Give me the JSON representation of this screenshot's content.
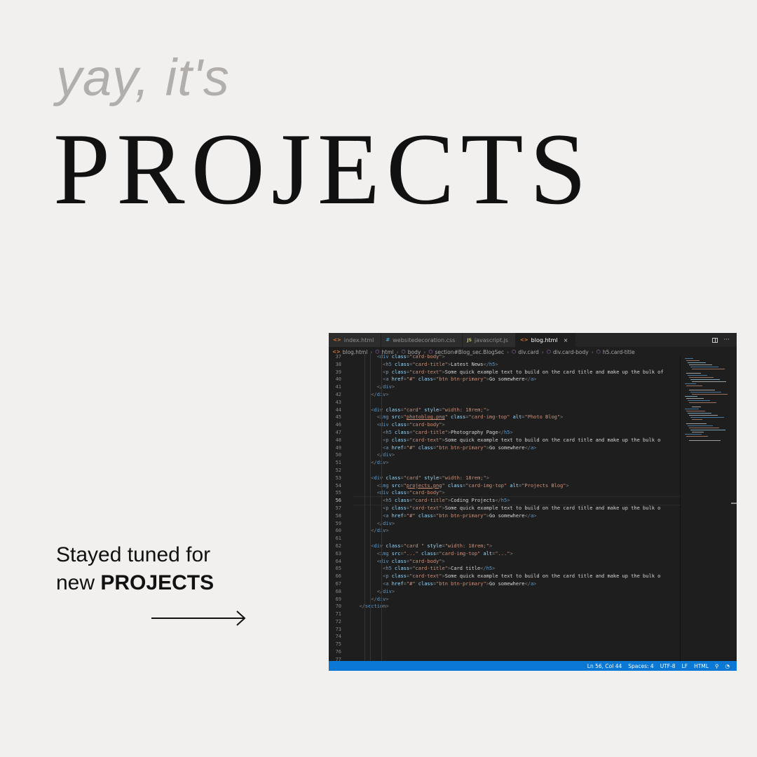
{
  "hero": {
    "kicker": "yay, it's",
    "headline": "PROJECTS",
    "tagline_line1": "Stayed tuned for",
    "tagline_line2_prefix": "new ",
    "tagline_line2_bold": "PROJECTS"
  },
  "editor": {
    "tabs": [
      {
        "label": "index.html",
        "icon": "<>",
        "type": "html"
      },
      {
        "label": "websitedecoration.css",
        "icon": "#",
        "type": "css"
      },
      {
        "label": "javascript.js",
        "icon": "JS",
        "type": "js"
      },
      {
        "label": "blog.html",
        "icon": "<>",
        "type": "html",
        "active": true,
        "close": "×"
      }
    ],
    "tab_actions": {
      "more": "···"
    },
    "breadcrumb": [
      {
        "label": "blog.html",
        "icon": "<>"
      },
      {
        "label": "html",
        "icon": "⬡"
      },
      {
        "label": "body",
        "icon": "⬡"
      },
      {
        "label": "section#Blog_sec.BlogSec",
        "icon": "⬡"
      },
      {
        "label": "div.card",
        "icon": "⬡"
      },
      {
        "label": "div.card-body",
        "icon": "⬡"
      },
      {
        "label": "h5.card-title",
        "icon": "⬡"
      }
    ],
    "line_numbers": [
      "37",
      "38",
      "39",
      "40",
      "41",
      "42",
      "43",
      "44",
      "45",
      "46",
      "47",
      "48",
      "49",
      "50",
      "51",
      "52",
      "53",
      "54",
      "55",
      "56",
      "57",
      "58",
      "59",
      "60",
      "61",
      "62",
      "63",
      "64",
      "65",
      "66",
      "67",
      "68",
      "69",
      "70",
      "71",
      "72",
      "73",
      "74",
      "75",
      "76",
      "77"
    ],
    "current_line": "56",
    "status": {
      "position": "Ln 56, Col 44",
      "spaces": "Spaces: 4",
      "encoding": "UTF-8",
      "eol": "LF",
      "language": "HTML"
    },
    "code_lines": [
      [
        [
          "        ",
          "p"
        ],
        [
          "<",
          "p"
        ],
        [
          "div",
          "t"
        ],
        [
          " class",
          "a"
        ],
        [
          "=",
          "p"
        ],
        [
          "\"card-body\"",
          "s"
        ],
        [
          ">",
          "p"
        ]
      ],
      [
        [
          "          ",
          "p"
        ],
        [
          "<",
          "p"
        ],
        [
          "h5",
          "t"
        ],
        [
          " class",
          "a"
        ],
        [
          "=",
          "p"
        ],
        [
          "\"card-title\"",
          "s"
        ],
        [
          ">",
          "p"
        ],
        [
          "Latest News",
          "x"
        ],
        [
          "</",
          "p"
        ],
        [
          "h5",
          "t"
        ],
        [
          ">",
          "p"
        ]
      ],
      [
        [
          "          ",
          "p"
        ],
        [
          "<",
          "p"
        ],
        [
          "p",
          "t"
        ],
        [
          " class",
          "a"
        ],
        [
          "=",
          "p"
        ],
        [
          "\"card-text\"",
          "s"
        ],
        [
          ">",
          "p"
        ],
        [
          "Some quick example text to build on the card title and make up the bulk of",
          "x"
        ]
      ],
      [
        [
          "          ",
          "p"
        ],
        [
          "<",
          "p"
        ],
        [
          "a",
          "t"
        ],
        [
          " href",
          "a"
        ],
        [
          "=",
          "p"
        ],
        [
          "\"#\"",
          "s"
        ],
        [
          " class",
          "a"
        ],
        [
          "=",
          "p"
        ],
        [
          "\"btn btn-primary\"",
          "s"
        ],
        [
          ">",
          "p"
        ],
        [
          "Go somewhere",
          "x"
        ],
        [
          "</",
          "p"
        ],
        [
          "a",
          "t"
        ],
        [
          ">",
          "p"
        ]
      ],
      [
        [
          "        ",
          "p"
        ],
        [
          "</",
          "p"
        ],
        [
          "div",
          "t"
        ],
        [
          ">",
          "p"
        ]
      ],
      [
        [
          "      ",
          "p"
        ],
        [
          "</",
          "p"
        ],
        [
          "div",
          "t"
        ],
        [
          ">",
          "p"
        ]
      ],
      [
        [
          "",
          "x"
        ]
      ],
      [
        [
          "      ",
          "p"
        ],
        [
          "<",
          "p"
        ],
        [
          "div",
          "t"
        ],
        [
          " class",
          "a"
        ],
        [
          "=",
          "p"
        ],
        [
          "\"card\"",
          "s"
        ],
        [
          " style",
          "a"
        ],
        [
          "=",
          "p"
        ],
        [
          "\"width: 18rem;\"",
          "s"
        ],
        [
          ">",
          "p"
        ]
      ],
      [
        [
          "        ",
          "p"
        ],
        [
          "<",
          "p"
        ],
        [
          "img",
          "t"
        ],
        [
          " src",
          "a"
        ],
        [
          "=",
          "p"
        ],
        [
          "\"",
          "s"
        ],
        [
          "photoblog.png",
          "su"
        ],
        [
          "\"",
          "s"
        ],
        [
          " class",
          "a"
        ],
        [
          "=",
          "p"
        ],
        [
          "\"card-img-top\"",
          "s"
        ],
        [
          " alt",
          "a"
        ],
        [
          "=",
          "p"
        ],
        [
          "\"Photo Blog\"",
          "s"
        ],
        [
          ">",
          "p"
        ]
      ],
      [
        [
          "        ",
          "p"
        ],
        [
          "<",
          "p"
        ],
        [
          "div",
          "t"
        ],
        [
          " class",
          "a"
        ],
        [
          "=",
          "p"
        ],
        [
          "\"card-body\"",
          "s"
        ],
        [
          ">",
          "p"
        ]
      ],
      [
        [
          "          ",
          "p"
        ],
        [
          "<",
          "p"
        ],
        [
          "h5",
          "t"
        ],
        [
          " class",
          "a"
        ],
        [
          "=",
          "p"
        ],
        [
          "\"card-title\"",
          "s"
        ],
        [
          ">",
          "p"
        ],
        [
          "Photography Page",
          "x"
        ],
        [
          "</",
          "p"
        ],
        [
          "h5",
          "t"
        ],
        [
          ">",
          "p"
        ]
      ],
      [
        [
          "          ",
          "p"
        ],
        [
          "<",
          "p"
        ],
        [
          "p",
          "t"
        ],
        [
          " class",
          "a"
        ],
        [
          "=",
          "p"
        ],
        [
          "\"card-text\"",
          "s"
        ],
        [
          ">",
          "p"
        ],
        [
          "Some quick example text to build on the card title and make up the bulk o",
          "x"
        ]
      ],
      [
        [
          "          ",
          "p"
        ],
        [
          "<",
          "p"
        ],
        [
          "a",
          "t"
        ],
        [
          " href",
          "a"
        ],
        [
          "=",
          "p"
        ],
        [
          "\"#\"",
          "s"
        ],
        [
          " class",
          "a"
        ],
        [
          "=",
          "p"
        ],
        [
          "\"btn btn-primary\"",
          "s"
        ],
        [
          ">",
          "p"
        ],
        [
          "Go somewhere",
          "x"
        ],
        [
          "</",
          "p"
        ],
        [
          "a",
          "t"
        ],
        [
          ">",
          "p"
        ]
      ],
      [
        [
          "        ",
          "p"
        ],
        [
          "</",
          "p"
        ],
        [
          "div",
          "t"
        ],
        [
          ">",
          "p"
        ]
      ],
      [
        [
          "      ",
          "p"
        ],
        [
          "</",
          "p"
        ],
        [
          "div",
          "t"
        ],
        [
          ">",
          "p"
        ]
      ],
      [
        [
          "",
          "x"
        ]
      ],
      [
        [
          "      ",
          "p"
        ],
        [
          "<",
          "p"
        ],
        [
          "div",
          "t"
        ],
        [
          " class",
          "a"
        ],
        [
          "=",
          "p"
        ],
        [
          "\"card\"",
          "s"
        ],
        [
          " style",
          "a"
        ],
        [
          "=",
          "p"
        ],
        [
          "\"width: 18rem;\"",
          "s"
        ],
        [
          ">",
          "p"
        ]
      ],
      [
        [
          "        ",
          "p"
        ],
        [
          "<",
          "p"
        ],
        [
          "img",
          "t"
        ],
        [
          " src",
          "a"
        ],
        [
          "=",
          "p"
        ],
        [
          "\"",
          "s"
        ],
        [
          "projects.png",
          "su"
        ],
        [
          "\"",
          "s"
        ],
        [
          " class",
          "a"
        ],
        [
          "=",
          "p"
        ],
        [
          "\"card-img-top\"",
          "s"
        ],
        [
          " alt",
          "a"
        ],
        [
          "=",
          "p"
        ],
        [
          "\"Projects Blog\"",
          "s"
        ],
        [
          ">",
          "p"
        ]
      ],
      [
        [
          "        ",
          "p"
        ],
        [
          "<",
          "p"
        ],
        [
          "div",
          "t"
        ],
        [
          " class",
          "a"
        ],
        [
          "=",
          "p"
        ],
        [
          "\"card-body\"",
          "s"
        ],
        [
          ">",
          "p"
        ]
      ],
      [
        [
          "          ",
          "p"
        ],
        [
          "<",
          "p"
        ],
        [
          "h5",
          "t"
        ],
        [
          " class",
          "a"
        ],
        [
          "=",
          "p"
        ],
        [
          "\"card-title\"",
          "s"
        ],
        [
          ">",
          "p"
        ],
        [
          "Coding Projects",
          "x"
        ],
        [
          "</",
          "p"
        ],
        [
          "h5",
          "t"
        ],
        [
          ">",
          "p"
        ]
      ],
      [
        [
          "          ",
          "p"
        ],
        [
          "<",
          "p"
        ],
        [
          "p",
          "t"
        ],
        [
          " class",
          "a"
        ],
        [
          "=",
          "p"
        ],
        [
          "\"card-text\"",
          "s"
        ],
        [
          ">",
          "p"
        ],
        [
          "Some quick example text to build on the card title and make up the bulk o",
          "x"
        ]
      ],
      [
        [
          "          ",
          "p"
        ],
        [
          "<",
          "p"
        ],
        [
          "a",
          "t"
        ],
        [
          " href",
          "a"
        ],
        [
          "=",
          "p"
        ],
        [
          "\"#\"",
          "s"
        ],
        [
          " class",
          "a"
        ],
        [
          "=",
          "p"
        ],
        [
          "\"btn btn-primary\"",
          "s"
        ],
        [
          ">",
          "p"
        ],
        [
          "Go somewhere",
          "x"
        ],
        [
          "</",
          "p"
        ],
        [
          "a",
          "t"
        ],
        [
          ">",
          "p"
        ]
      ],
      [
        [
          "        ",
          "p"
        ],
        [
          "</",
          "p"
        ],
        [
          "div",
          "t"
        ],
        [
          ">",
          "p"
        ]
      ],
      [
        [
          "      ",
          "p"
        ],
        [
          "</",
          "p"
        ],
        [
          "div",
          "t"
        ],
        [
          ">",
          "p"
        ]
      ],
      [
        [
          "",
          "x"
        ]
      ],
      [
        [
          "      ",
          "p"
        ],
        [
          "<",
          "p"
        ],
        [
          "div",
          "t"
        ],
        [
          " class",
          "a"
        ],
        [
          "=",
          "p"
        ],
        [
          "\"card \"",
          "s"
        ],
        [
          " style",
          "a"
        ],
        [
          "=",
          "p"
        ],
        [
          "\"width: 18rem;\"",
          "s"
        ],
        [
          ">",
          "p"
        ]
      ],
      [
        [
          "        ",
          "p"
        ],
        [
          "<",
          "p"
        ],
        [
          "img",
          "t"
        ],
        [
          " src",
          "a"
        ],
        [
          "=",
          "p"
        ],
        [
          "\"...\"",
          "s"
        ],
        [
          " class",
          "a"
        ],
        [
          "=",
          "p"
        ],
        [
          "\"card-img-top\"",
          "s"
        ],
        [
          " alt",
          "a"
        ],
        [
          "=",
          "p"
        ],
        [
          "\"...\"",
          "s"
        ],
        [
          ">",
          "p"
        ]
      ],
      [
        [
          "        ",
          "p"
        ],
        [
          "<",
          "p"
        ],
        [
          "div",
          "t"
        ],
        [
          " class",
          "a"
        ],
        [
          "=",
          "p"
        ],
        [
          "\"card-body\"",
          "s"
        ],
        [
          ">",
          "p"
        ]
      ],
      [
        [
          "          ",
          "p"
        ],
        [
          "<",
          "p"
        ],
        [
          "h5",
          "t"
        ],
        [
          " class",
          "a"
        ],
        [
          "=",
          "p"
        ],
        [
          "\"card-title\"",
          "s"
        ],
        [
          ">",
          "p"
        ],
        [
          "Card title",
          "x"
        ],
        [
          "</",
          "p"
        ],
        [
          "h5",
          "t"
        ],
        [
          ">",
          "p"
        ]
      ],
      [
        [
          "          ",
          "p"
        ],
        [
          "<",
          "p"
        ],
        [
          "p",
          "t"
        ],
        [
          " class",
          "a"
        ],
        [
          "=",
          "p"
        ],
        [
          "\"card-text\"",
          "s"
        ],
        [
          ">",
          "p"
        ],
        [
          "Some quick example text to build on the card title and make up the bulk o",
          "x"
        ]
      ],
      [
        [
          "          ",
          "p"
        ],
        [
          "<",
          "p"
        ],
        [
          "a",
          "t"
        ],
        [
          " href",
          "a"
        ],
        [
          "=",
          "p"
        ],
        [
          "\"#\"",
          "s"
        ],
        [
          " class",
          "a"
        ],
        [
          "=",
          "p"
        ],
        [
          "\"btn btn-primary\"",
          "s"
        ],
        [
          ">",
          "p"
        ],
        [
          "Go somewhere",
          "x"
        ],
        [
          "</",
          "p"
        ],
        [
          "a",
          "t"
        ],
        [
          ">",
          "p"
        ]
      ],
      [
        [
          "        ",
          "p"
        ],
        [
          "</",
          "p"
        ],
        [
          "div",
          "t"
        ],
        [
          ">",
          "p"
        ]
      ],
      [
        [
          "      ",
          "p"
        ],
        [
          "</",
          "p"
        ],
        [
          "div",
          "t"
        ],
        [
          ">",
          "p"
        ]
      ],
      [
        [
          "  ",
          "p"
        ],
        [
          "</",
          "p"
        ],
        [
          "section",
          "t"
        ],
        [
          ">",
          "p"
        ]
      ],
      [
        [
          "",
          "x"
        ]
      ],
      [
        [
          "",
          "x"
        ]
      ],
      [
        [
          "",
          "x"
        ]
      ],
      [
        [
          "",
          "x"
        ]
      ],
      [
        [
          "",
          "x"
        ]
      ],
      [
        [
          "",
          "x"
        ]
      ],
      [
        [
          "",
          "x"
        ]
      ]
    ]
  }
}
